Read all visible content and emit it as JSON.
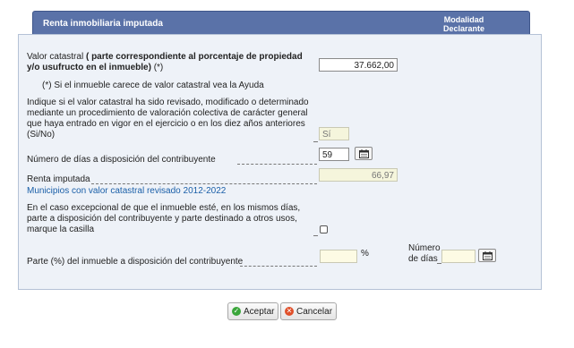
{
  "header": {
    "title": "Renta inmobiliaria imputada",
    "modalidad_line1": "Modalidad",
    "modalidad_line2": "Declarante"
  },
  "form": {
    "valor_catastral_label_prefix": "Valor catastral",
    "valor_catastral_label_bold": "( parte correspondiente al porcentaje de propiedad y/o usufructo en el inmueble)",
    "valor_catastral_label_suffix": "(*)",
    "valor_catastral_value": "37.662,00",
    "note": "(*) Si el inmueble carece de valor catastral vea la Ayuda",
    "revisado_label": "Indique si el valor catastral ha sido revisado, modificado o determinado mediante un procedimiento de valoración colectiva de carácter general que haya entrado en vigor en el ejercicio o en los diez años anteriores (Si/No)",
    "revisado_value": "Sí",
    "dias_label": "Número de días a disposición del contribuyente",
    "dias_value": "59",
    "renta_label": "Renta imputada",
    "renta_value": "66,97",
    "municipios_link": "Municipios con valor catastral revisado 2012-2022",
    "excepcional_label": "En el caso excepcional de que el inmueble esté, en los mismos días, parte a disposición del contribuyente y parte destinado a otros usos, marque la casilla",
    "parte_label": "Parte (%) del inmueble a disposición del contribuyente",
    "parte_value": "",
    "percent_sign": "%",
    "numero_dias_line1": "Número",
    "numero_dias_line2": "de días",
    "numero_dias_value": ""
  },
  "buttons": {
    "aceptar": "Aceptar",
    "cancelar": "Cancelar"
  },
  "icons": {
    "calendar": "calendar-icon",
    "accept": "check-circle-icon",
    "cancel": "cancel-circle-icon"
  },
  "colors": {
    "header_bg": "#5a72a8",
    "panel_bg": "#eef2f8",
    "link": "#1a5fa8",
    "readonly_bg": "#f5f5dc",
    "accept_icon": "#3aa63a",
    "cancel_icon": "#e0502a"
  }
}
